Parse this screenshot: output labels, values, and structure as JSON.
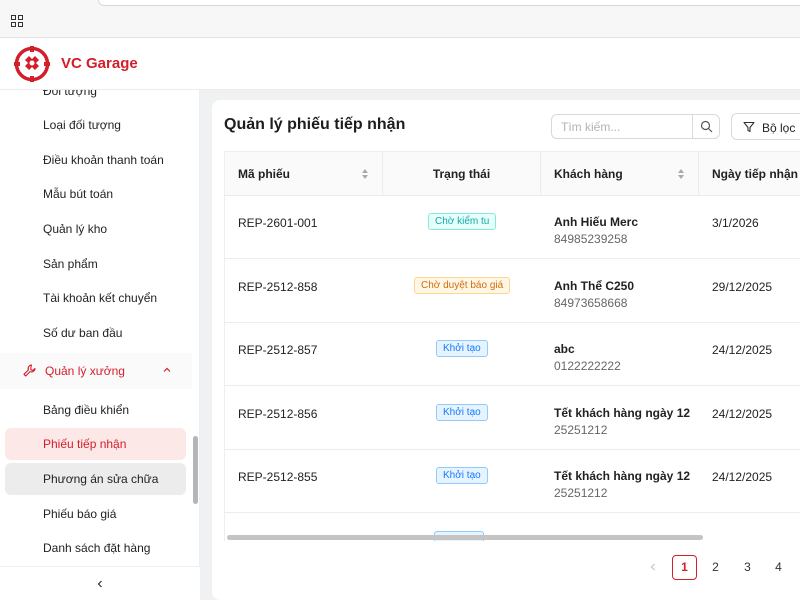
{
  "app": {
    "brand": "VC Garage"
  },
  "sidebar": {
    "items_top": [
      {
        "label": "Đối tượng"
      },
      {
        "label": "Loại đối tượng"
      },
      {
        "label": "Điều khoản thanh toán"
      },
      {
        "label": "Mẫu bút toán"
      },
      {
        "label": "Quản lý kho"
      },
      {
        "label": "Sản phẩm"
      },
      {
        "label": "Tài khoản kết chuyển"
      },
      {
        "label": "Số dư ban đầu"
      }
    ],
    "group": {
      "label": "Quản lý xưởng",
      "icon": "wrench-icon",
      "expanded": true
    },
    "group_items": [
      {
        "label": "Bảng điều khiển",
        "state": "normal"
      },
      {
        "label": "Phiếu tiếp nhận",
        "state": "active"
      },
      {
        "label": "Phương án sửa chữa",
        "state": "hover"
      },
      {
        "label": "Phiếu báo giá",
        "state": "normal"
      },
      {
        "label": "Danh sách đặt hàng",
        "state": "normal"
      }
    ],
    "collapse_icon": "chevron-left-icon"
  },
  "main": {
    "title": "Quản lý phiếu tiếp nhận",
    "search": {
      "placeholder": "Tìm kiếm...",
      "value": ""
    },
    "filter_label": "Bộ lọc"
  },
  "table": {
    "columns": [
      {
        "label": "Mã phiếu",
        "sortable": true
      },
      {
        "label": "Trạng thái",
        "sortable": false
      },
      {
        "label": "Khách hàng",
        "sortable": true
      },
      {
        "label": "Ngày tiếp nhận",
        "sortable": true
      }
    ],
    "rows": [
      {
        "code": "REP-2601-001",
        "status": "Chờ kiểm tu",
        "status_kind": "cyan",
        "customer": "Anh Hiếu Merc",
        "phone": "84985239258",
        "date": "3/1/2026"
      },
      {
        "code": "REP-2512-858",
        "status": "Chờ duyệt báo giá",
        "status_kind": "orange",
        "customer": "Anh Thể C250",
        "phone": "84973658668",
        "date": "29/12/2025"
      },
      {
        "code": "REP-2512-857",
        "status": "Khởi tạo",
        "status_kind": "blue",
        "customer": "abc",
        "phone": "0122222222",
        "date": "24/12/2025"
      },
      {
        "code": "REP-2512-856",
        "status": "Khởi tạo",
        "status_kind": "blue",
        "customer": "Tết khách hàng ngày 12",
        "phone": "25251212",
        "date": "24/12/2025"
      },
      {
        "code": "REP-2512-855",
        "status": "Khởi tạo",
        "status_kind": "blue",
        "customer": "Tết khách hàng ngày 12",
        "phone": "25251212",
        "date": "24/12/2025"
      }
    ],
    "tag_colors": {
      "cyan": {
        "text": "#13a8a8",
        "bg": "#e6fffb",
        "border": "#87e8de"
      },
      "orange": {
        "text": "#d46b08",
        "bg": "#fff7e6",
        "border": "#ffd591"
      },
      "blue": {
        "text": "#1677ff",
        "bg": "#e6f4ff",
        "border": "#91caff"
      }
    }
  },
  "pagination": {
    "prev_icon": "chevron-left-icon",
    "pages": [
      "1",
      "2",
      "3",
      "4"
    ],
    "current": "1"
  },
  "colors": {
    "brand": "#d21f2b",
    "active_bg": "#fde8e8"
  }
}
